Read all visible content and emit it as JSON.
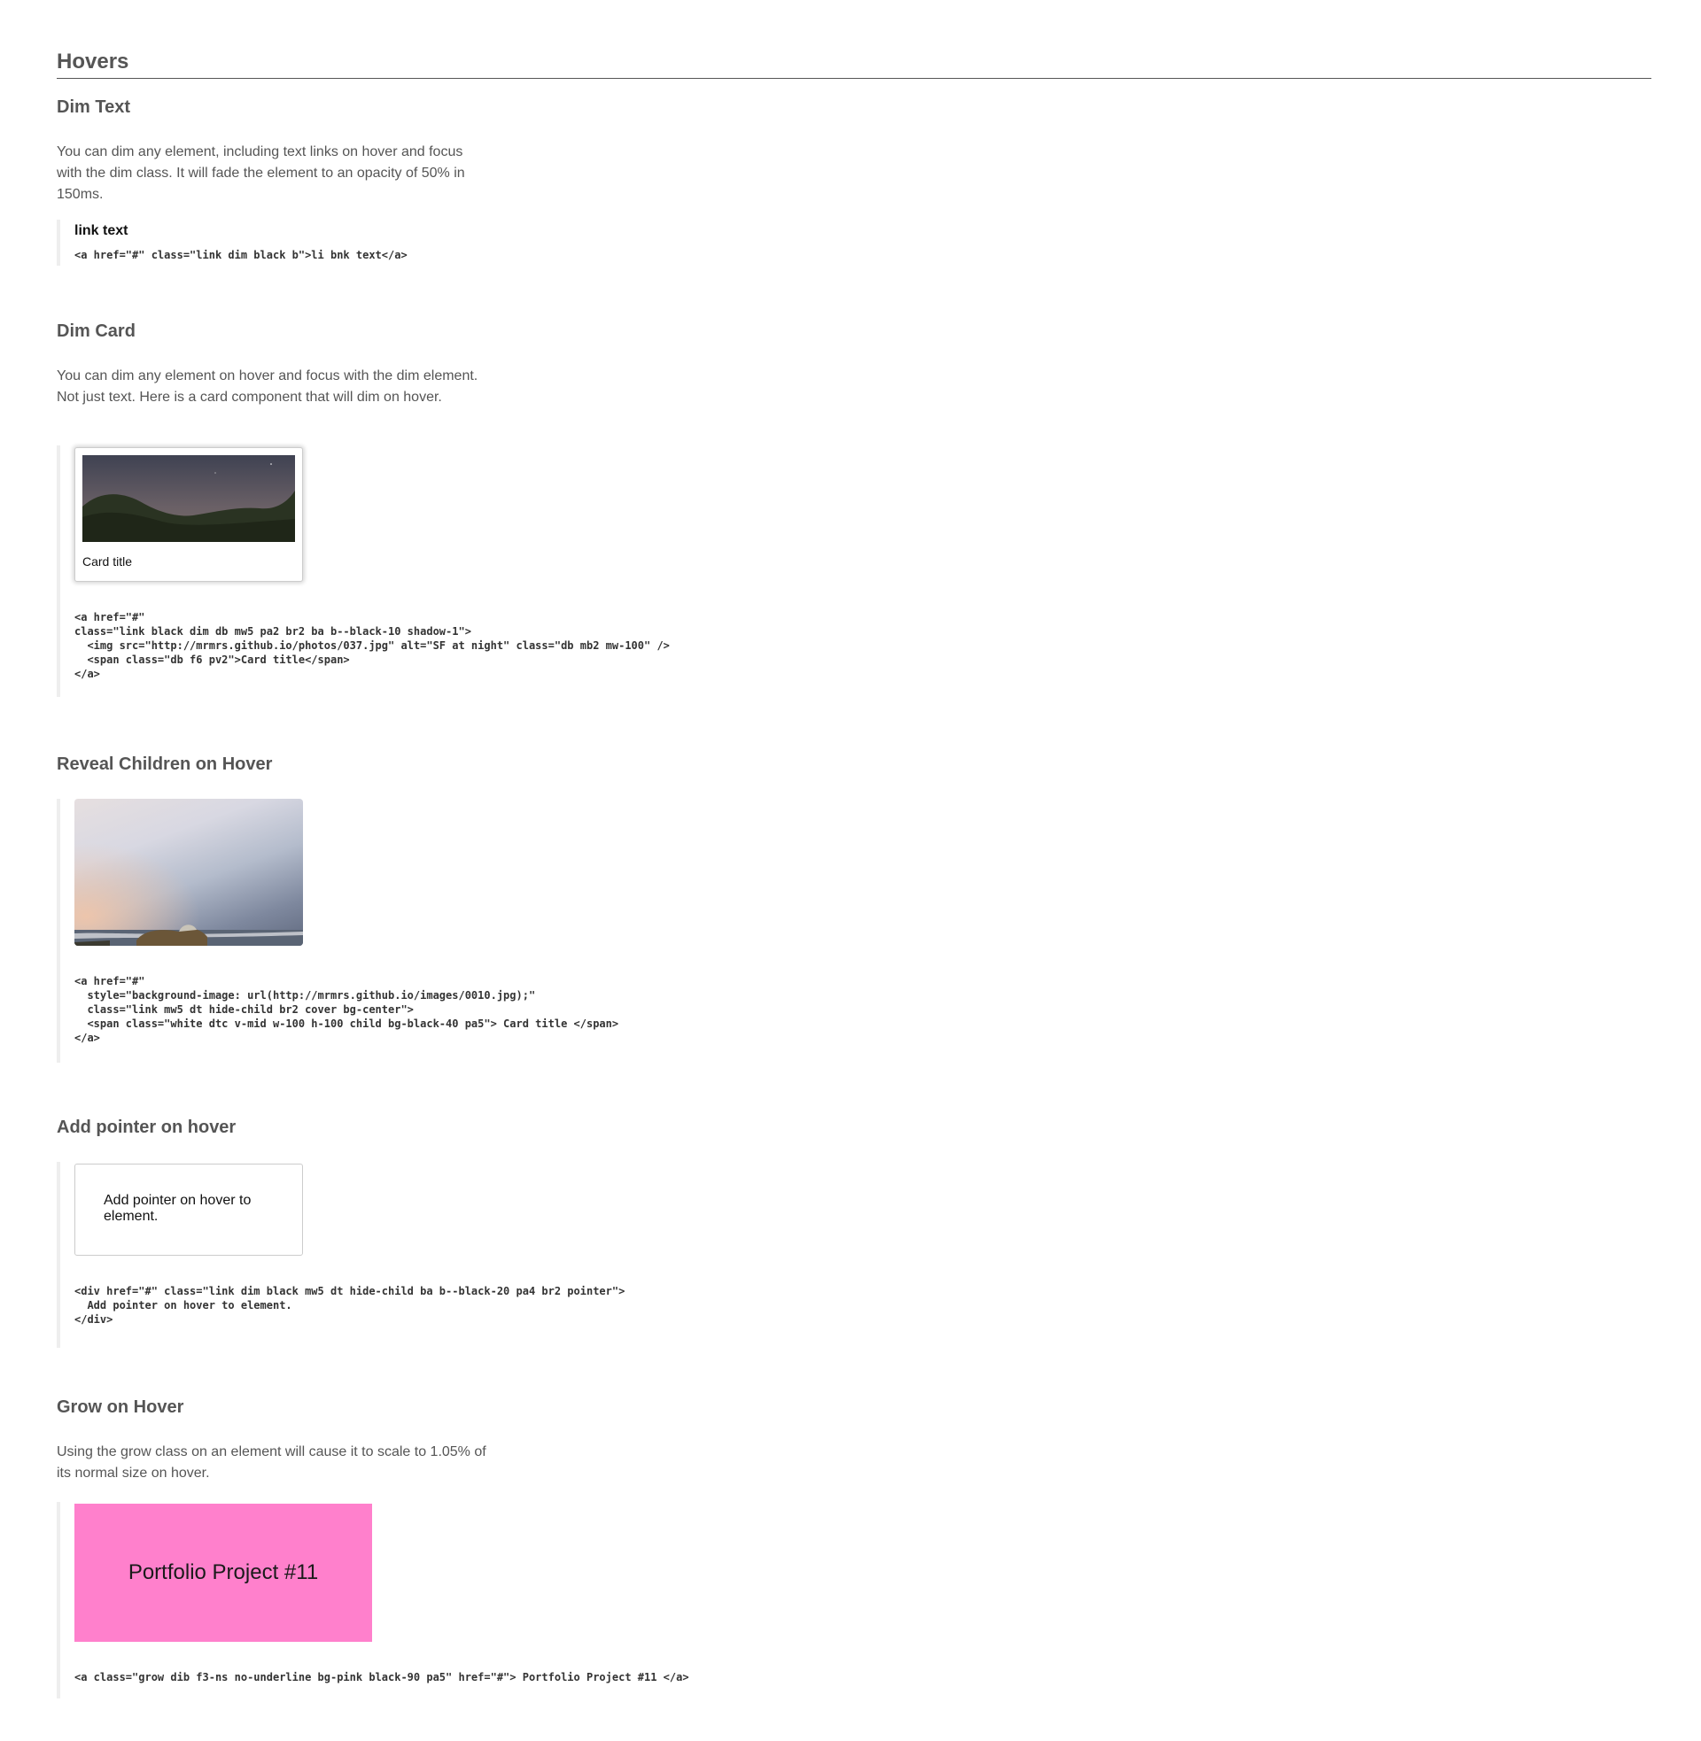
{
  "page": {
    "title": "Hovers"
  },
  "sections": {
    "dim_text": {
      "heading": "Dim Text",
      "description": "You can dim any element, including text links on hover and focus with the dim class. It will fade the element to an opacity of 50% in 150ms.",
      "link_label": "link text",
      "code": "<a href=\"#\" class=\"link dim black b\">li bnk text</a>"
    },
    "dim_card": {
      "heading": "Dim Card",
      "description": "You can dim any element on hover and focus with the dim element. Not just text. Here is a card component that will dim on hover.",
      "card_title": "Card title",
      "code": "<a href=\"#\"\nclass=\"link black dim db mw5 pa2 br2 ba b--black-10 shadow-1\">\n  <img src=\"http://mrmrs.github.io/photos/037.jpg\" alt=\"SF at night\" class=\"db mb2 mw-100\" />\n  <span class=\"db f6 pv2\">Card title</span>\n</a>"
    },
    "reveal_children": {
      "heading": "Reveal Children on Hover",
      "code": "<a href=\"#\"\n  style=\"background-image: url(http://mrmrs.github.io/images/0010.jpg);\"\n  class=\"link mw5 dt hide-child br2 cover bg-center\">\n  <span class=\"white dtc v-mid w-100 h-100 child bg-black-40 pa5\"> Card title </span>\n</a>"
    },
    "add_pointer": {
      "heading": "Add pointer on hover",
      "box_text": "Add pointer on hover to element.",
      "code": "<div href=\"#\" class=\"link dim black mw5 dt hide-child ba b--black-20 pa4 br2 pointer\">\n  Add pointer on hover to element.\n</div>"
    },
    "grow": {
      "heading": "Grow on Hover",
      "description": "Using the grow class on an element will cause it to scale to 1.05% of its normal size on hover.",
      "box_text": "Portfolio Project #11",
      "code": "<a class=\"grow dib f3-ns no-underline bg-pink black-90 pa5\" href=\"#\"> Portfolio Project #11 </a>"
    }
  },
  "colors": {
    "pink": "#ff80cc",
    "heading": "#555555",
    "border_accent": "#eeeeee"
  }
}
